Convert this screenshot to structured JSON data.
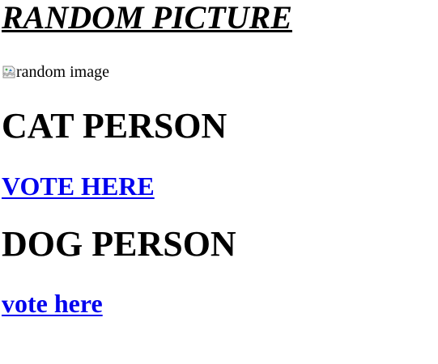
{
  "page": {
    "title": "RANDOM PICTURE"
  },
  "image": {
    "alt_text": "random image",
    "icon": "broken-image-icon"
  },
  "cat_section": {
    "heading": "CAT PERSON",
    "link_label": "VOTE HERE"
  },
  "dog_section": {
    "heading": "DOG PERSON",
    "link_label": "vote here"
  },
  "colors": {
    "link": "#0000ee",
    "text": "#000000",
    "background": "#ffffff"
  }
}
